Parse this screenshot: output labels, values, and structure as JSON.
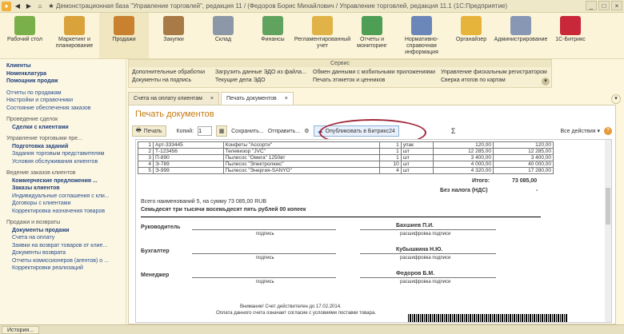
{
  "window": {
    "title": "Демонстрационная база \"Управление торговлей\", редакция 11 / (Федоров Борис Михайлович / Управление торговлей, редакция 11.1 (1С:Предприятие)"
  },
  "sections": [
    {
      "label": "Рабочий стол",
      "icon": "desktop-icon",
      "color": "#7ab04a"
    },
    {
      "label": "Маркетинг и планирование",
      "icon": "marketing-icon",
      "color": "#d9a23a"
    },
    {
      "label": "Продажи",
      "icon": "sales-icon",
      "color": "#c9812f"
    },
    {
      "label": "Закупки",
      "icon": "purchases-icon",
      "color": "#a87a45"
    },
    {
      "label": "Склад",
      "icon": "warehouse-icon",
      "color": "#8c98a8"
    },
    {
      "label": "Финансы",
      "icon": "finance-icon",
      "color": "#5fa35f"
    },
    {
      "label": "Регламентированный учет",
      "icon": "accounting-icon",
      "color": "#e0b248"
    },
    {
      "label": "Отчеты и мониторинг",
      "icon": "reports-icon",
      "color": "#4f9e55"
    },
    {
      "label": "Нормативно-справочная информация",
      "icon": "reference-icon",
      "color": "#6b86b8"
    },
    {
      "label": "Органайзер",
      "icon": "organizer-icon",
      "color": "#e6b43a"
    },
    {
      "label": "Администрирование",
      "icon": "admin-icon",
      "color": "#8898b4"
    },
    {
      "label": "1С-Битрикс",
      "icon": "bitrix-icon",
      "color": "#c8283a"
    }
  ],
  "left_panel": [
    {
      "text": "Клиенты",
      "style": "bold"
    },
    {
      "text": "Номенклатура",
      "style": "bold"
    },
    {
      "text": "Помощник продаж",
      "style": "bold"
    },
    {
      "text": "Отчеты по продажам",
      "style": "plain",
      "gap": true
    },
    {
      "text": "Настройки и справочники",
      "style": "plain"
    },
    {
      "text": "Состояние обеспечения заказов",
      "style": "plain"
    },
    {
      "text": "Проведение сделок",
      "style": "head"
    },
    {
      "text": "Сделки с клиентами",
      "style": "bold-indent"
    },
    {
      "text": "Управление торговыми пре...",
      "style": "head"
    },
    {
      "text": "Подготовка заданий",
      "style": "bold-indent"
    },
    {
      "text": "Задания торговым представителям",
      "style": "indent"
    },
    {
      "text": "Условия обслуживания клиентов",
      "style": "indent"
    },
    {
      "text": "Ведение заказов клиентов",
      "style": "head"
    },
    {
      "text": "Коммерческие предложения ...",
      "style": "bold-indent"
    },
    {
      "text": "Заказы клиентов",
      "style": "bold-indent"
    },
    {
      "text": "Индивидуальные соглашения с кли...",
      "style": "indent"
    },
    {
      "text": "Договоры с клиентами",
      "style": "indent"
    },
    {
      "text": "Корректировка назначения товаров",
      "style": "indent"
    },
    {
      "text": "Продажи и возвраты",
      "style": "head"
    },
    {
      "text": "Документы продажи",
      "style": "bold-indent"
    },
    {
      "text": "Счета на оплату",
      "style": "indent"
    },
    {
      "text": "Заявки на возврат товаров от клие...",
      "style": "indent"
    },
    {
      "text": "Документы возврата",
      "style": "indent"
    },
    {
      "text": "Отчеты комиссионеров (агентов) о ...",
      "style": "indent"
    },
    {
      "text": "Корректировки реализаций",
      "style": "indent"
    }
  ],
  "service": {
    "title": "Сервис",
    "col1": [
      "Дополнительные обработки",
      "Документы на подпись"
    ],
    "col2": [
      "Загрузить данные ЭДО из файла...",
      "Текущие дела ЭДО"
    ],
    "col3": [
      "Обмен данными с мобильными приложениями",
      "Печать этикеток и ценников"
    ],
    "col4": [
      "Управление фискальным регистратором",
      "Сверка итогов по картам"
    ]
  },
  "tabs": [
    {
      "label": "Счета на оплату клиентам"
    },
    {
      "label": "Печать документов"
    }
  ],
  "doc": {
    "title": "Печать документов",
    "print_label": "Печать",
    "copies_label": "Копий:",
    "copies_value": "1",
    "save_label": "Сохранить...",
    "send_label": "Отправить...",
    "publish_label": "Опубликовать в Битрикс24",
    "all_actions": "Все действия ▾"
  },
  "invoice_rows": [
    {
      "n": "1",
      "code": "Арт-333445",
      "name": "Конфеты \"Ассорти\"",
      "qty": "1",
      "unit": "упак",
      "price": "120,00",
      "sum": "120,00"
    },
    {
      "n": "2",
      "code": "Т-123456",
      "name": "Телевизор \"JVC\"",
      "qty": "1",
      "unit": "шт",
      "price": "12 285,00",
      "sum": "12 285,00"
    },
    {
      "n": "3",
      "code": "П-890",
      "name": "Пылесос \"Омега\" 1250вт",
      "qty": "1",
      "unit": "шт",
      "price": "3 400,00",
      "sum": "3 400,00"
    },
    {
      "n": "4",
      "code": "Э-789",
      "name": "Пылесос \"Электролюкс\"",
      "qty": "10",
      "unit": "шт",
      "price": "4 000,00",
      "sum": "40 000,00"
    },
    {
      "n": "5",
      "code": "Э-999",
      "name": "Пылесос \"Энергия-SANYO\"",
      "qty": "4",
      "unit": "шт",
      "price": "4 320,00",
      "sum": "17 280,00"
    }
  ],
  "totals": {
    "itogo_label": "Итого:",
    "itogo_value": "73 085,00",
    "nds_label": "Без налога (НДС)",
    "nds_value": "-",
    "summary": "Всего наименований 5, на сумму 73 085,00 RUB",
    "words": "Семьдесят три тысячи восемьдесят пять рублей 00 копеек"
  },
  "signatures": [
    {
      "role": "Руководитель",
      "name": "Бахшиев П.И."
    },
    {
      "role": "Бухгалтер",
      "name": "Кубышкина Н.Ю."
    },
    {
      "role": "Менеджер",
      "name": "Федоров Б.М."
    }
  ],
  "sig_labels": {
    "sign": "подпись",
    "decode": "расшифровка подписи"
  },
  "notice": {
    "line1": "Внимание! Счет действителен до 17.02.2014.",
    "line2": "Оплата данного счета означает согласие с условиями поставки товара."
  },
  "status": {
    "history": "История..."
  }
}
